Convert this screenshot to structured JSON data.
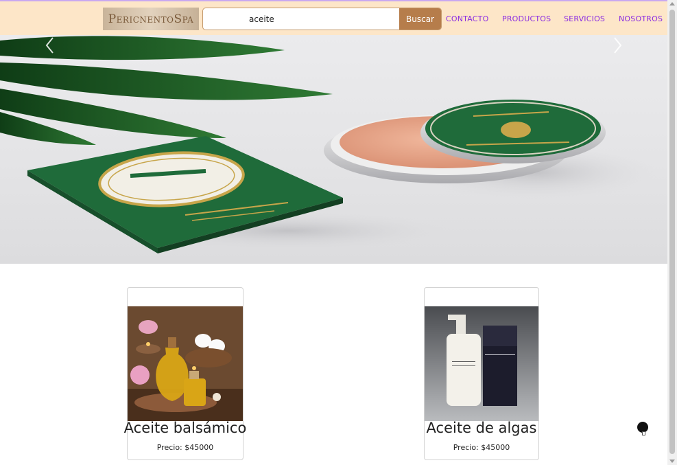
{
  "brand": {
    "logo_text": "PericnentoSpa"
  },
  "search": {
    "value": "aceite",
    "placeholder": "",
    "button_label": "Buscar"
  },
  "nav": {
    "items": [
      {
        "label": "CONTACTO"
      },
      {
        "label": "PRODUCTOS"
      },
      {
        "label": "SERVICIOS"
      },
      {
        "label": "NOSOTROS"
      }
    ]
  },
  "carousel": {
    "prev_icon": "chevron-left-icon",
    "next_icon": "chevron-right-icon"
  },
  "products": [
    {
      "name": "Aceite balsámico",
      "price": "Precio: $45000"
    },
    {
      "name": "Aceite de algas",
      "price": "Precio: $45000"
    }
  ],
  "colors": {
    "header_bg": "#fde6c8",
    "nav_link": "#8a2be2",
    "search_button": "#b67d4b",
    "brand_green": "#1f6b3a"
  }
}
